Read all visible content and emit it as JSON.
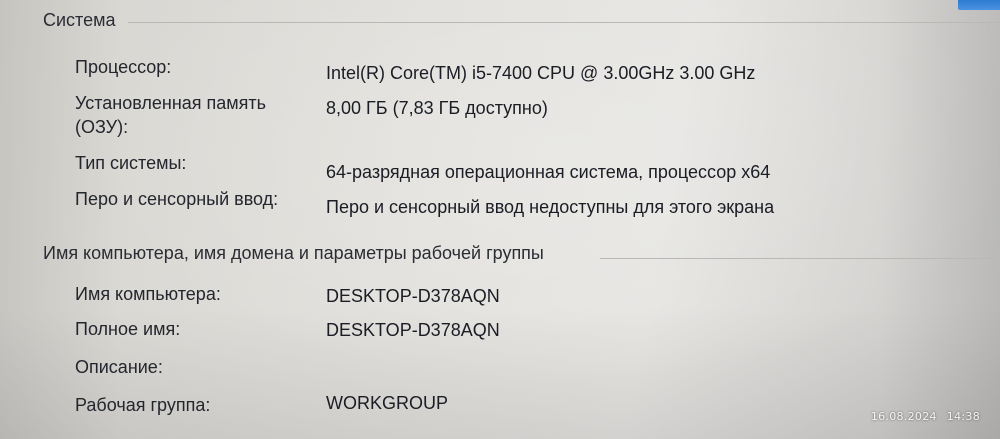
{
  "system_section": {
    "title": "Система",
    "rows": [
      {
        "label": "Процессор:",
        "value": "Intel(R) Core(TM) i5-7400 CPU @ 3.00GHz   3.00 GHz"
      },
      {
        "label_line1": "Установленная память",
        "label_line2": "(ОЗУ):",
        "value": "8,00 ГБ (7,83 ГБ доступно)"
      },
      {
        "label": "Тип системы:",
        "value": "64-разрядная операционная система, процессор x64"
      },
      {
        "label": "Перо и сенсорный ввод:",
        "value": "Перо и сенсорный ввод недоступны для этого экрана"
      }
    ]
  },
  "computer_section": {
    "title": "Имя компьютера, имя домена и параметры рабочей группы",
    "rows": [
      {
        "label": "Имя компьютера:",
        "value": "DESKTOP-D378AQN"
      },
      {
        "label": "Полное имя:",
        "value": "DESKTOP-D378AQN"
      },
      {
        "label": "Описание:",
        "value": ""
      },
      {
        "label": "Рабочая группа:",
        "value": "WORKGROUP"
      }
    ]
  },
  "photo_stamp": {
    "date": "16.08.2024",
    "time": "14:38"
  }
}
